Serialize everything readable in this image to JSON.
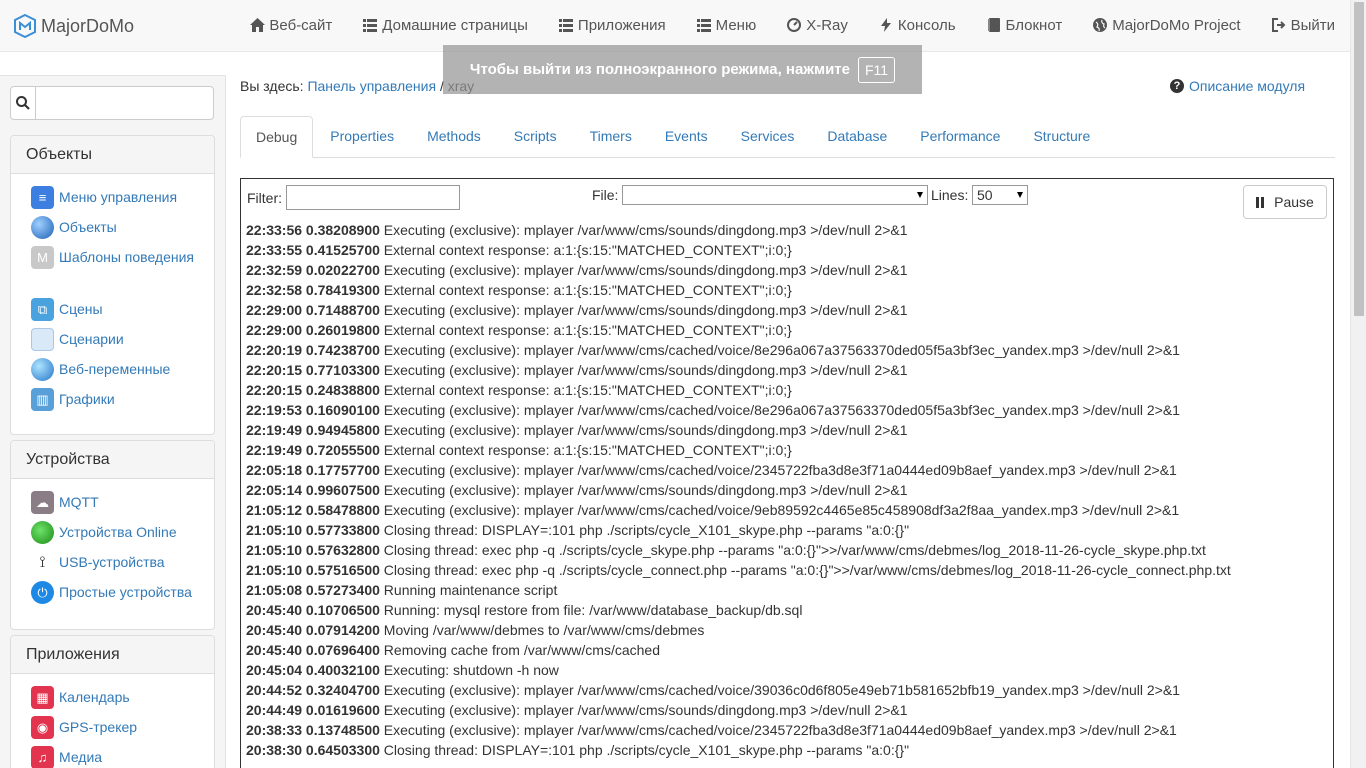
{
  "brand": {
    "name": "MajorDoMo"
  },
  "nav": [
    {
      "label": "Веб-сайт",
      "icon": "home-icon"
    },
    {
      "label": "Домашние страницы",
      "icon": "list-icon"
    },
    {
      "label": "Приложения",
      "icon": "list-icon"
    },
    {
      "label": "Меню",
      "icon": "list-icon"
    },
    {
      "label": "X-Ray",
      "icon": "dashboard-icon"
    },
    {
      "label": "Консоль",
      "icon": "bolt-icon"
    },
    {
      "label": "Блокнот",
      "icon": "book-icon"
    },
    {
      "label": "MajorDoMo Project",
      "icon": "globe-icon"
    },
    {
      "label": "Выйти",
      "icon": "logout-icon"
    }
  ],
  "fullscreen_notice": {
    "text": "Чтобы выйти из полноэкранного режима, нажмите",
    "key": "F11"
  },
  "search": {
    "placeholder": ""
  },
  "sidebar": {
    "panels": [
      {
        "title": "Объекты",
        "items": [
          {
            "label": "Меню управления",
            "icon": "menu-icon"
          },
          {
            "label": "Объекты",
            "icon": "globe-icon"
          },
          {
            "label": "Шаблоны поведения",
            "icon": "template-icon"
          },
          {
            "label": "Сцены",
            "icon": "scenes-icon"
          },
          {
            "label": "Сценарии",
            "icon": "scripts-icon"
          },
          {
            "label": "Веб-переменные",
            "icon": "web-vars-icon"
          },
          {
            "label": "Графики",
            "icon": "charts-icon"
          }
        ]
      },
      {
        "title": "Устройства",
        "items": [
          {
            "label": "MQTT",
            "icon": "cloud-icon"
          },
          {
            "label": "Устройства Online",
            "icon": "online-icon"
          },
          {
            "label": "USB-устройства",
            "icon": "usb-icon"
          },
          {
            "label": "Простые устройства",
            "icon": "power-icon"
          }
        ]
      },
      {
        "title": "Приложения",
        "items": [
          {
            "label": "Календарь",
            "icon": "calendar-icon"
          },
          {
            "label": "GPS-трекер",
            "icon": "gps-icon"
          },
          {
            "label": "Медиа",
            "icon": "media-icon"
          }
        ]
      }
    ]
  },
  "breadcrumb": {
    "prefix": "Вы здесь:",
    "link": "Панель управления",
    "separator": "/",
    "current": "xray"
  },
  "help": {
    "label": "Описание модуля"
  },
  "tabs": [
    "Debug",
    "Properties",
    "Methods",
    "Scripts",
    "Timers",
    "Events",
    "Services",
    "Database",
    "Performance",
    "Structure"
  ],
  "active_tab": "Debug",
  "controls": {
    "filter_label": "Filter:",
    "filter_value": "",
    "file_label": "File:",
    "file_value": "",
    "lines_label": "Lines:",
    "lines_value": "50",
    "pause_label": "Pause"
  },
  "log": [
    {
      "t": "22:33:56 0.38208900",
      "m": "Executing (exclusive): mplayer /var/www/cms/sounds/dingdong.mp3 >/dev/null 2>&1"
    },
    {
      "t": "22:33:55 0.41525700",
      "m": "External context response: a:1:{s:15:\"MATCHED_CONTEXT\";i:0;}"
    },
    {
      "t": "22:32:59 0.02022700",
      "m": "Executing (exclusive): mplayer /var/www/cms/sounds/dingdong.mp3 >/dev/null 2>&1"
    },
    {
      "t": "22:32:58 0.78419300",
      "m": "External context response: a:1:{s:15:\"MATCHED_CONTEXT\";i:0;}"
    },
    {
      "t": "22:29:00 0.71488700",
      "m": "Executing (exclusive): mplayer /var/www/cms/sounds/dingdong.mp3 >/dev/null 2>&1"
    },
    {
      "t": "22:29:00 0.26019800",
      "m": "External context response: a:1:{s:15:\"MATCHED_CONTEXT\";i:0;}"
    },
    {
      "t": "22:20:19 0.74238700",
      "m": "Executing (exclusive): mplayer /var/www/cms/cached/voice/8e296a067a37563370ded05f5a3bf3ec_yandex.mp3 >/dev/null 2>&1"
    },
    {
      "t": "22:20:15 0.77103300",
      "m": "Executing (exclusive): mplayer /var/www/cms/sounds/dingdong.mp3 >/dev/null 2>&1"
    },
    {
      "t": "22:20:15 0.24838800",
      "m": "External context response: a:1:{s:15:\"MATCHED_CONTEXT\";i:0;}"
    },
    {
      "t": "22:19:53 0.16090100",
      "m": "Executing (exclusive): mplayer /var/www/cms/cached/voice/8e296a067a37563370ded05f5a3bf3ec_yandex.mp3 >/dev/null 2>&1"
    },
    {
      "t": "22:19:49 0.94945800",
      "m": "Executing (exclusive): mplayer /var/www/cms/sounds/dingdong.mp3 >/dev/null 2>&1"
    },
    {
      "t": "22:19:49 0.72055500",
      "m": "External context response: a:1:{s:15:\"MATCHED_CONTEXT\";i:0;}"
    },
    {
      "t": "22:05:18 0.17757700",
      "m": "Executing (exclusive): mplayer /var/www/cms/cached/voice/2345722fba3d8e3f71a0444ed09b8aef_yandex.mp3 >/dev/null 2>&1"
    },
    {
      "t": "22:05:14 0.99607500",
      "m": "Executing (exclusive): mplayer /var/www/cms/sounds/dingdong.mp3 >/dev/null 2>&1"
    },
    {
      "t": "21:05:12 0.58478800",
      "m": "Executing (exclusive): mplayer /var/www/cms/cached/voice/9eb89592c4465e85c458908df3a2f8aa_yandex.mp3 >/dev/null 2>&1"
    },
    {
      "t": "21:05:10 0.57733800",
      "m": "Closing thread: DISPLAY=:101 php ./scripts/cycle_X101_skype.php --params \"a:0:{}\""
    },
    {
      "t": "21:05:10 0.57632800",
      "m": "Closing thread: exec php -q ./scripts/cycle_skype.php --params \"a:0:{}\">>/var/www/cms/debmes/log_2018-11-26-cycle_skype.php.txt"
    },
    {
      "t": "21:05:10 0.57516500",
      "m": "Closing thread: exec php -q ./scripts/cycle_connect.php --params \"a:0:{}\">>/var/www/cms/debmes/log_2018-11-26-cycle_connect.php.txt"
    },
    {
      "t": "21:05:08 0.57273400",
      "m": "Running maintenance script"
    },
    {
      "t": "20:45:40 0.10706500",
      "m": "Running: mysql restore from file: /var/www/database_backup/db.sql"
    },
    {
      "t": "20:45:40 0.07914200",
      "m": "Moving /var/www/debmes to /var/www/cms/debmes"
    },
    {
      "t": "20:45:40 0.07696400",
      "m": "Removing cache from /var/www/cms/cached"
    },
    {
      "t": "20:45:04 0.40032100",
      "m": "Executing: shutdown -h now"
    },
    {
      "t": "20:44:52 0.32404700",
      "m": "Executing (exclusive): mplayer /var/www/cms/cached/voice/39036c0d6f805e49eb71b581652bfb19_yandex.mp3 >/dev/null 2>&1"
    },
    {
      "t": "20:44:49 0.01619600",
      "m": "Executing (exclusive): mplayer /var/www/cms/sounds/dingdong.mp3 >/dev/null 2>&1"
    },
    {
      "t": "20:38:33 0.13748500",
      "m": "Executing (exclusive): mplayer /var/www/cms/cached/voice/2345722fba3d8e3f71a0444ed09b8aef_yandex.mp3 >/dev/null 2>&1"
    },
    {
      "t": "20:38:30 0.64503300",
      "m": "Closing thread: DISPLAY=:101 php ./scripts/cycle_X101_skype.php --params \"a:0:{}\""
    }
  ]
}
